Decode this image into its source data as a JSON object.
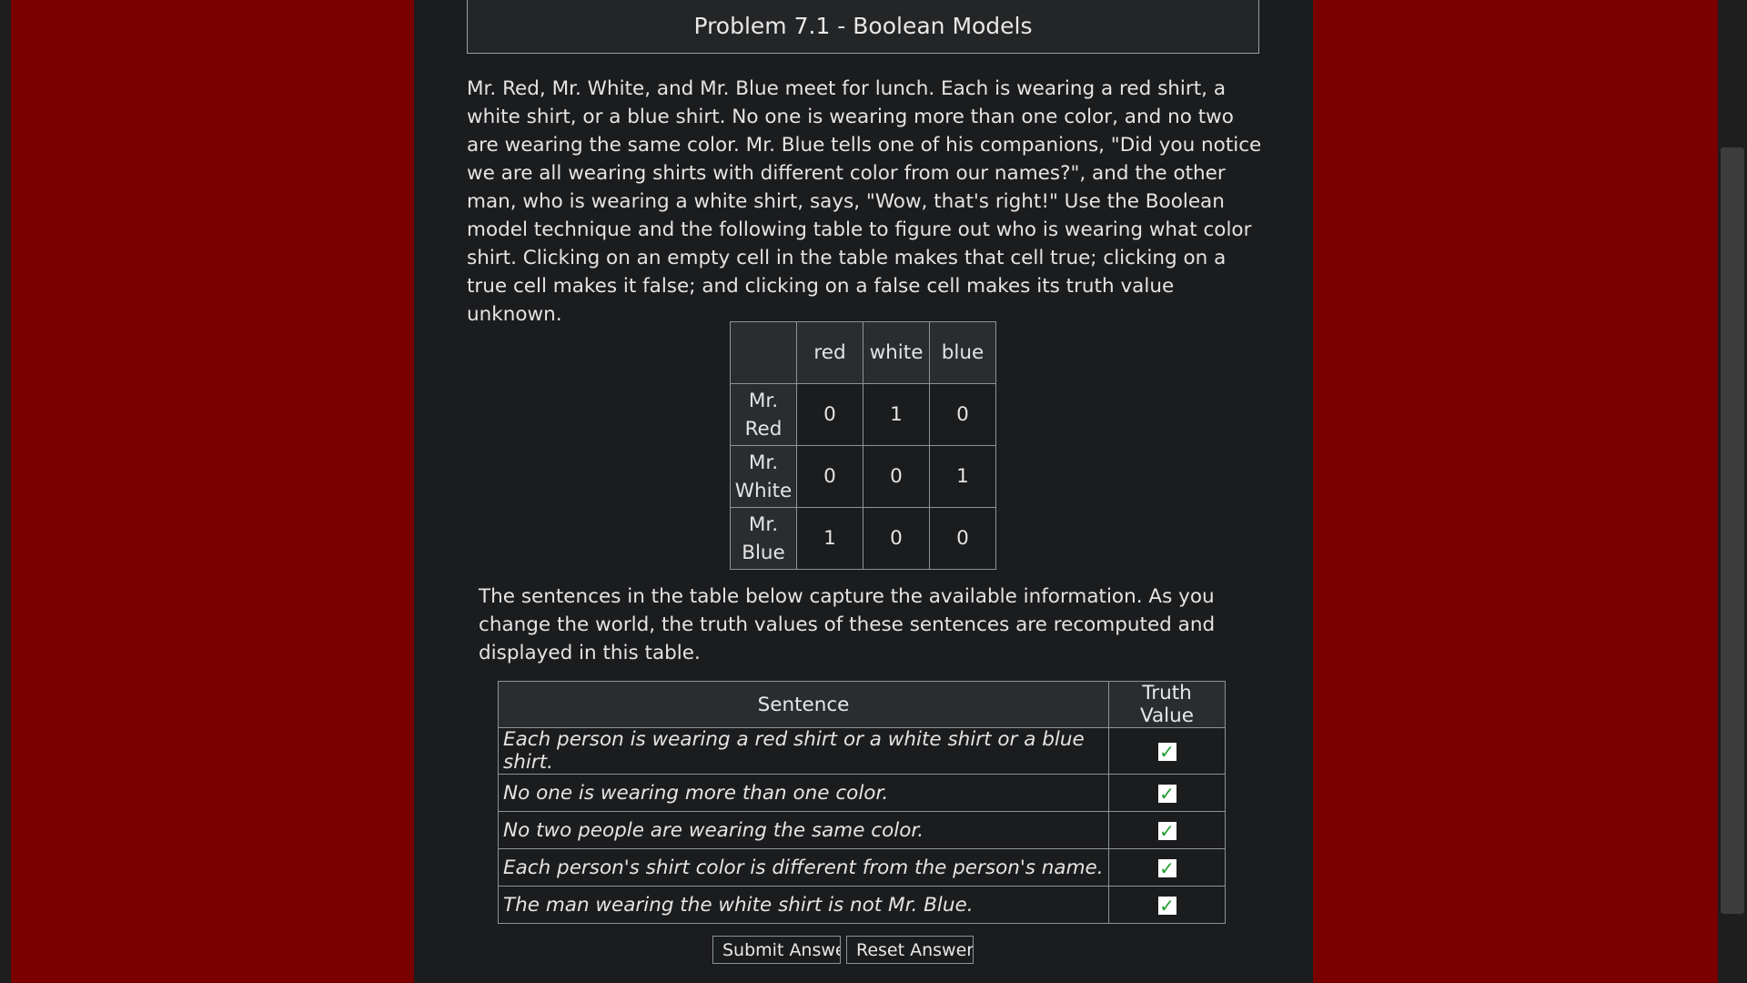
{
  "title": "Problem 7.1 - Boolean Models",
  "intro": "Mr. Red, Mr. White, and Mr. Blue meet for lunch. Each is wearing a red shirt, a white shirt, or a blue shirt. No one is wearing more than one color, and no two are wearing the same color. Mr. Blue tells one of his companions, \"Did you notice we are all wearing shirts with different color from our names?\", and the other man, who is wearing a white shirt, says, \"Wow, that's right!\" Use the Boolean model technique and the following table to figure out who is wearing what color shirt. Clicking on an empty cell in the table makes that cell true; clicking on a true cell makes it false; and clicking on a false cell makes its truth value unknown.",
  "world": {
    "columns": [
      "red",
      "white",
      "blue"
    ],
    "rows": [
      {
        "name": "Mr. Red",
        "values": [
          "0",
          "1",
          "0"
        ]
      },
      {
        "name": "Mr. White",
        "values": [
          "0",
          "0",
          "1"
        ]
      },
      {
        "name": "Mr. Blue",
        "values": [
          "1",
          "0",
          "0"
        ]
      }
    ]
  },
  "para2": "The sentences in the table below capture the available information. As you change the world, the truth values of these sentences are recomputed and displayed in this table.",
  "sentences_table": {
    "header_sentence": "Sentence",
    "header_truth": "Truth Value",
    "rows": [
      {
        "sentence": "Each person is wearing a red shirt or a white shirt or a blue shirt.",
        "truth": "✓"
      },
      {
        "sentence": "No one is wearing more than one color.",
        "truth": "✓"
      },
      {
        "sentence": "No two people are wearing the same color.",
        "truth": "✓"
      },
      {
        "sentence": "Each person's shirt color is different from the person's name.",
        "truth": "✓"
      },
      {
        "sentence": "The man wearing the white shirt is not Mr. Blue.",
        "truth": "✓"
      }
    ]
  },
  "buttons": {
    "submit": "Submit Answers",
    "reset": "Reset Answers"
  },
  "colors": {
    "background_side": "#7a0000",
    "content_bg": "#1b1c1e",
    "check_color": "#1f9d2f"
  }
}
